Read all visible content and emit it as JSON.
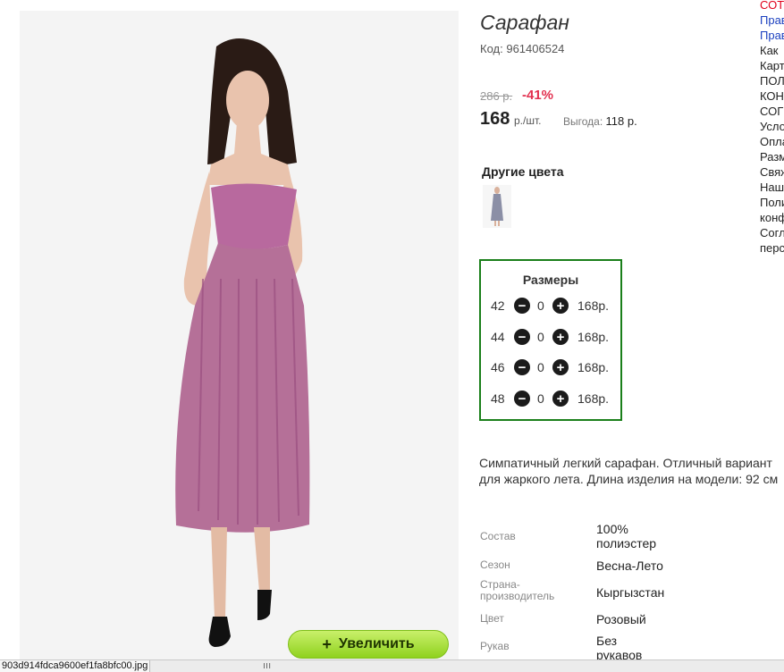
{
  "product": {
    "title": "Сарафан",
    "code_label": "Код:",
    "code": "961406524",
    "old_price": "286 р.",
    "discount": "-41%",
    "price": "168",
    "price_unit": "р./шт.",
    "benefit_label": "Выгода:",
    "benefit_value": "118 р.",
    "other_colors_label": "Другие цвета",
    "zoom_label": "Увеличить",
    "zoom_icon": "+"
  },
  "sizes": {
    "title": "Размеры",
    "rows": [
      {
        "size": "42",
        "qty": "0",
        "price": "168р."
      },
      {
        "size": "44",
        "qty": "0",
        "price": "168р."
      },
      {
        "size": "46",
        "qty": "0",
        "price": "168р."
      },
      {
        "size": "48",
        "qty": "0",
        "price": "168р."
      }
    ]
  },
  "description": "Симпатичный легкий сарафан. Отличный вариант для жаркого лета. Длина изделия на модели: 92 см",
  "properties": [
    {
      "label": "Состав",
      "value": "100% полиэстер"
    },
    {
      "label": "Сезон",
      "value": "Весна-Лето"
    },
    {
      "label": "Страна-производитель",
      "value": "Кыргызстан"
    },
    {
      "label": "Цвет",
      "value": "Розовый"
    },
    {
      "label": "Рукав",
      "value": "Без рукавов"
    }
  ],
  "right_menu": [
    {
      "text": "СОТ",
      "style": "red"
    },
    {
      "text": "Прав",
      "style": "link"
    },
    {
      "text": "Прав",
      "style": "link"
    },
    {
      "text": "Как",
      "style": "plain"
    },
    {
      "text": "Карт",
      "style": "plain"
    },
    {
      "text": "ПОЛ",
      "style": "plain"
    },
    {
      "text": "КОН",
      "style": "plain"
    },
    {
      "text": "СОГ",
      "style": "plain"
    },
    {
      "text": "Усло",
      "style": "plain"
    },
    {
      "text": "Опла",
      "style": "plain"
    },
    {
      "text": "Разм",
      "style": "plain"
    },
    {
      "text": "Свяж",
      "style": "plain"
    },
    {
      "text": "Наш",
      "style": "plain"
    },
    {
      "text": "Поли",
      "style": "plain"
    },
    {
      "text": "конф",
      "style": "plain"
    },
    {
      "text": "Согл",
      "style": "plain"
    },
    {
      "text": "перс",
      "style": "plain"
    }
  ],
  "statusbar": {
    "filename": "903d914fdca9600ef1fa8bfc00.jpg",
    "grip": "ııı"
  },
  "colors": {
    "accent_green": "#1a7f1a",
    "discount_red": "#e2304f",
    "zoom_button": "#a6e02f",
    "dress": "#b86f9e"
  },
  "icons": {
    "minus": "minus-circle-icon",
    "plus": "plus-circle-icon"
  }
}
